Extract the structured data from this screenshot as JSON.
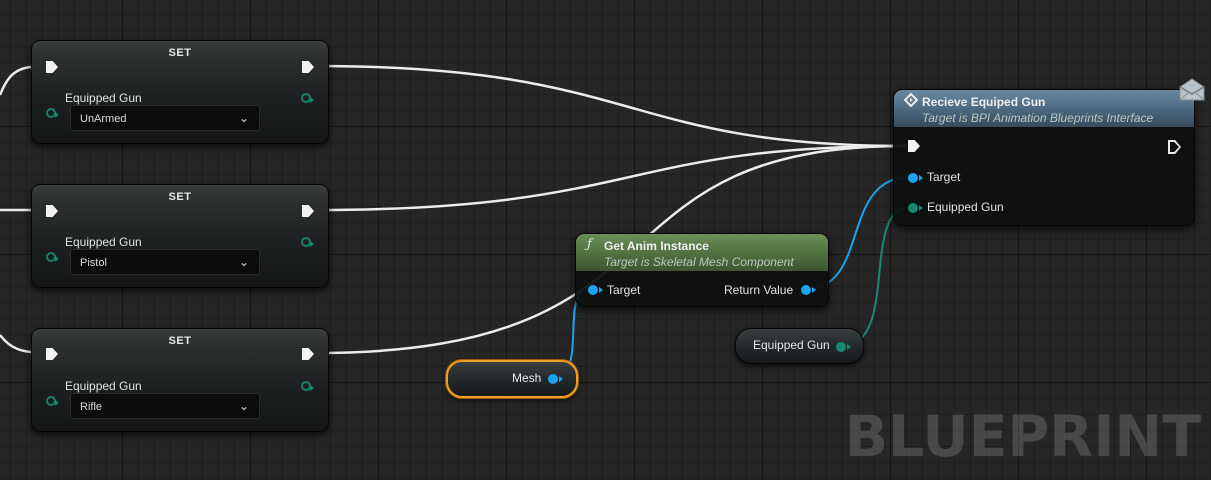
{
  "set_nodes": [
    {
      "title": "SET",
      "var_label": "Equipped Gun",
      "value": "UnArmed"
    },
    {
      "title": "SET",
      "var_label": "Equipped Gun",
      "value": "Pistol"
    },
    {
      "title": "SET",
      "var_label": "Equipped Gun",
      "value": "Rifle"
    }
  ],
  "anim_node": {
    "icon": "function-icon",
    "title": "Get Anim Instance",
    "subtitle": "Target is Skeletal Mesh Component",
    "target_label": "Target",
    "return_label": "Return Value"
  },
  "receive_node": {
    "icon": "event-diamond-icon",
    "title": "Recieve Equiped Gun",
    "subtitle": "Target is BPI Animation Blueprints Interface",
    "target_label": "Target",
    "gun_label": "Equipped Gun"
  },
  "mesh_getter": {
    "label": "Mesh"
  },
  "gun_getter": {
    "label": "Equipped Gun"
  },
  "watermark": "BLUEPRINT",
  "colors": {
    "exec_wire": "#ececec",
    "object_pin": "#1aa3ef",
    "enum_pin": "#148a73",
    "selection": "#f0a020",
    "anim_header": "#5b7c4a",
    "receive_header": "#4a6a80"
  }
}
